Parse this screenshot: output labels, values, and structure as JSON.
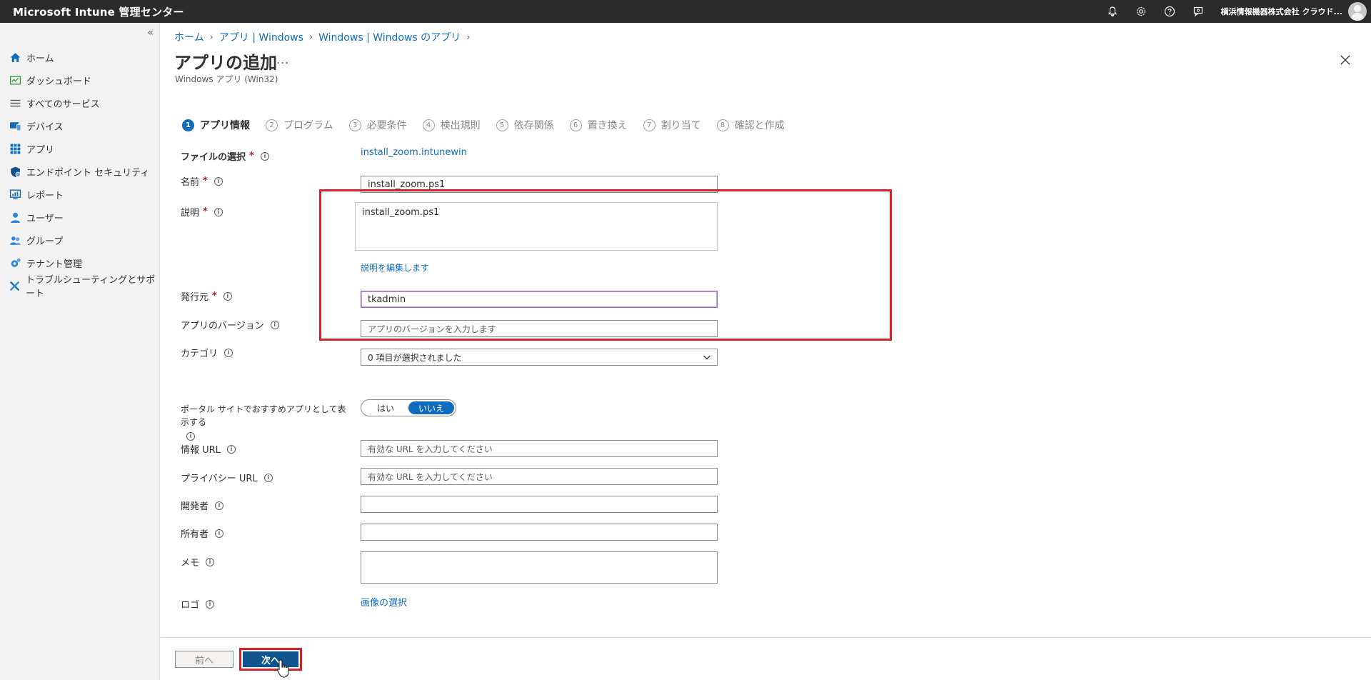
{
  "app": {
    "title": "Microsoft Intune 管理センター",
    "tenant": "横浜情報機器株式会社 クラウド..."
  },
  "sidebar": {
    "items": [
      {
        "label": "ホーム",
        "icon": "home-icon"
      },
      {
        "label": "ダッシュボード",
        "icon": "dashboard-icon"
      },
      {
        "label": "すべてのサービス",
        "icon": "list-icon"
      },
      {
        "label": "デバイス",
        "icon": "device-icon"
      },
      {
        "label": "アプリ",
        "icon": "apps-grid-icon"
      },
      {
        "label": "エンドポイント セキュリティ",
        "icon": "shield-icon"
      },
      {
        "label": "レポート",
        "icon": "report-icon"
      },
      {
        "label": "ユーザー",
        "icon": "user-icon"
      },
      {
        "label": "グループ",
        "icon": "group-icon"
      },
      {
        "label": "テナント管理",
        "icon": "gear-icon"
      },
      {
        "label": "トラブルシューティングとサポート",
        "icon": "wrench-icon"
      }
    ]
  },
  "breadcrumb": [
    "ホーム",
    "アプリ | Windows",
    "Windows | Windows のアプリ"
  ],
  "page": {
    "title": "アプリの追加",
    "more": "...",
    "subtitle": "Windows アプリ (Win32)"
  },
  "steps": [
    {
      "num": "1",
      "label": "アプリ情報"
    },
    {
      "num": "2",
      "label": "プログラム"
    },
    {
      "num": "3",
      "label": "必要条件"
    },
    {
      "num": "4",
      "label": "検出規則"
    },
    {
      "num": "5",
      "label": "依存関係"
    },
    {
      "num": "6",
      "label": "置き換え"
    },
    {
      "num": "7",
      "label": "割り当て"
    },
    {
      "num": "8",
      "label": "確認と作成"
    }
  ],
  "form": {
    "file": {
      "label": "ファイルの選択",
      "value": "install_zoom.intunewin"
    },
    "name": {
      "label": "名前",
      "value": "install_zoom.ps1"
    },
    "description": {
      "label": "説明",
      "value": "install_zoom.ps1",
      "edit_link": "説明を編集します"
    },
    "publisher": {
      "label": "発行元",
      "value": "tkadmin"
    },
    "version": {
      "label": "アプリのバージョン",
      "placeholder": "アプリのバージョンを入力します"
    },
    "category": {
      "label": "カテゴリ",
      "value": "0 項目が選択されました"
    },
    "featured": {
      "label": "ポータル サイトでおすすめアプリとして表示する",
      "yes": "はい",
      "no": "いいえ"
    },
    "info_url": {
      "label": "情報 URL",
      "placeholder": "有効な URL を入力してください"
    },
    "privacy_url": {
      "label": "プライバシー URL",
      "placeholder": "有効な URL を入力してください"
    },
    "developer": {
      "label": "開発者",
      "value": ""
    },
    "owner": {
      "label": "所有者",
      "value": ""
    },
    "notes": {
      "label": "メモ",
      "value": ""
    },
    "logo": {
      "label": "ロゴ",
      "link": "画像の選択"
    },
    "required_mark": "*",
    "info_mark": "i"
  },
  "footer": {
    "prev": "前へ",
    "next": "次へ"
  },
  "colors": {
    "accent": "#0f6cbd",
    "highlight": "#d6202a",
    "topbar": "#2b2b2b"
  }
}
